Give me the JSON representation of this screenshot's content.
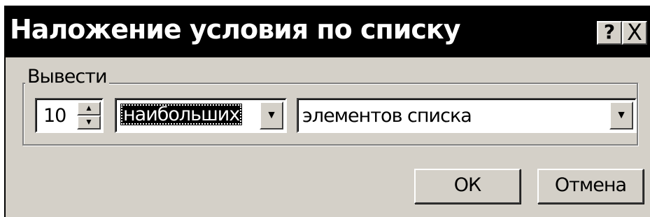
{
  "dialog": {
    "title": "Наложение условия по списку",
    "help_label": "?",
    "close_label": "X"
  },
  "group": {
    "label": "Вывести",
    "count_value": "10",
    "mode_value": "наибольших",
    "items_value": "элементов списка"
  },
  "buttons": {
    "ok_label": "ОК",
    "cancel_label": "Отмена"
  },
  "icons": {
    "spin_up": "▲",
    "spin_down": "▼",
    "dropdown": "▼"
  }
}
